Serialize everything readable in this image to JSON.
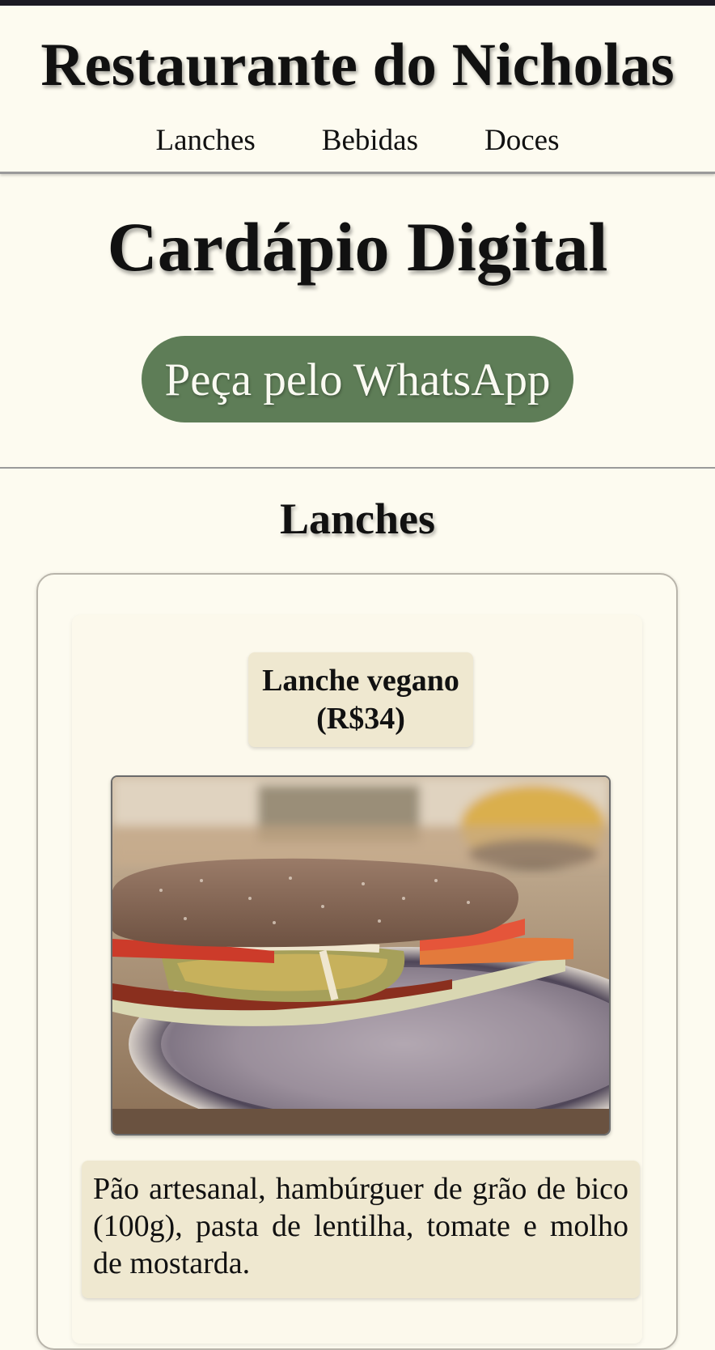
{
  "header": {
    "title": "Restaurante do Nicholas",
    "nav": [
      "Lanches",
      "Bebidas",
      "Doces"
    ]
  },
  "hero": {
    "title": "Cardápio Digital",
    "whatsapp_button": "Peça pelo WhatsApp"
  },
  "sections": [
    {
      "title": "Lanches",
      "items": [
        {
          "name_line1": "Lanche vegano",
          "name_line2": "(R$34)",
          "image_icon": "vegan-sandwich-photo",
          "description": "Pão artesanal, hambúrguer de grão de bico (100g), pasta de lentilha, tomate e molho de mostarda."
        }
      ]
    }
  ],
  "colors": {
    "background": "#fdfbf0",
    "accent": "#5e7d57",
    "card_label": "#efe8d0"
  }
}
